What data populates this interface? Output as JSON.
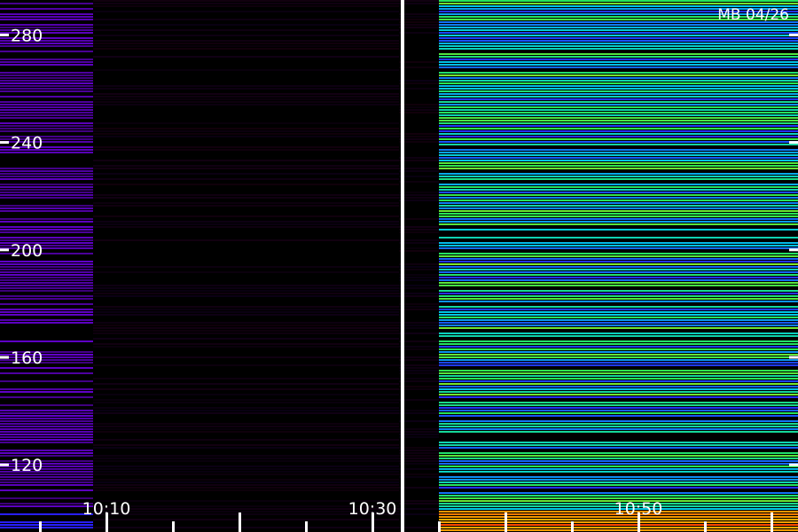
{
  "chart_data": {
    "type": "heatmap",
    "title": "MB 04/26",
    "xlabel": "",
    "ylabel": "",
    "x_ticks": [
      "10:10",
      "10:30",
      "10:50"
    ],
    "y_ticks": [
      120,
      160,
      200,
      240,
      280
    ],
    "ylim": [
      95,
      293
    ],
    "xlim": [
      "10:02",
      "11:02"
    ],
    "segments": [
      {
        "name": "",
        "from": "10:02",
        "to": "10:09",
        "level": 0.25,
        "colorscale": "purple-blue"
      },
      {
        "name": "",
        "from": "10:09",
        "to": "10:32",
        "level": 0.02,
        "colorscale": "dark"
      },
      {
        "name": "",
        "from": "10:32",
        "to": "10:35",
        "level": 0.0,
        "colorscale": "dark"
      },
      {
        "name": "",
        "from": "10:35",
        "to": "11:02",
        "level": 0.6,
        "colorscale": "rainbow"
      }
    ],
    "grid": false,
    "colors": {
      "background": "#000000",
      "text": "#ffffff",
      "low": "#3a00a0",
      "mid": "#00c8e0",
      "high": "#ff4000"
    }
  }
}
